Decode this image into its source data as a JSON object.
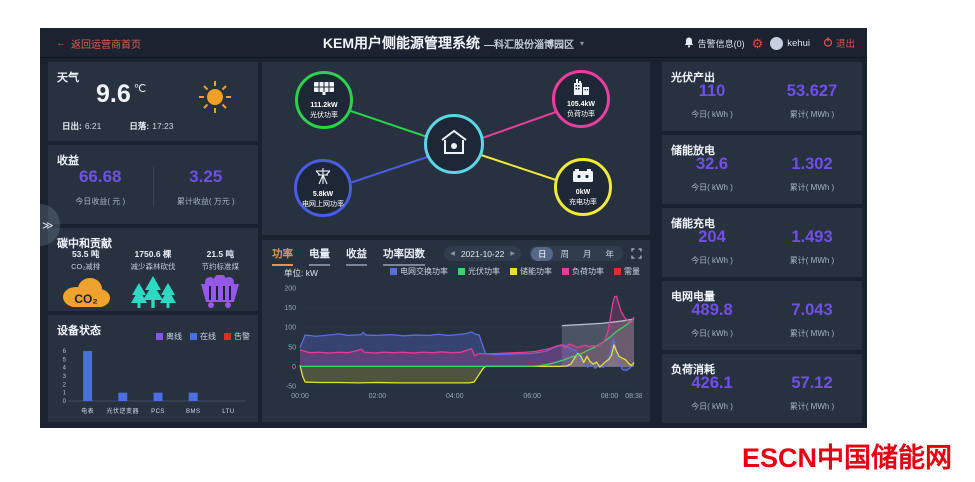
{
  "icons": {
    "back_arrow": "←",
    "chevron_down": "▾",
    "prev": "◀",
    "next": "▶",
    "expand": "≫",
    "gear": "⚙"
  },
  "header": {
    "back_label": "返回运营商首页",
    "title": "KEM用户侧能源管理系统",
    "park": "—科汇股份淄博园区",
    "alarm": "告警信息(0)",
    "user": "kehui",
    "logout": "退出"
  },
  "weather": {
    "title": "天气",
    "temp": "9.6",
    "unit": "℃",
    "sunrise_label": "日出:",
    "sunrise": "6:21",
    "sunset_label": "日落:",
    "sunset": "17:23"
  },
  "revenue": {
    "title": "收益",
    "today": "66.68",
    "today_label": "今日收益( 元 )",
    "total": "3.25",
    "total_label": "累计收益( 万元 )"
  },
  "carbon": {
    "title": "碳中和贡献",
    "co2_text": "CO₂",
    "items": [
      {
        "value": "53.5 吨",
        "label": "CO₂减排",
        "color": "#f0a32c"
      },
      {
        "value": "1750.6 棵",
        "label": "减少森林砍伐",
        "color": "#2ed9c3"
      },
      {
        "value": "21.5 吨",
        "label": "节约标准煤",
        "color": "#9558e8"
      }
    ]
  },
  "device_status": {
    "title": "设备状态",
    "legend": [
      {
        "label": "离线",
        "color": "#8655f0"
      },
      {
        "label": "在线",
        "color": "#4a6fe0"
      },
      {
        "label": "告警",
        "color": "#e02a2a"
      }
    ]
  },
  "flow": {
    "center_color": "#5cd6e6",
    "nodes": [
      {
        "value": "111.2kW",
        "label": "光伏功率",
        "color": "#2bd14b"
      },
      {
        "value": "105.4kW",
        "label": "负荷功率",
        "color": "#ea3e9e"
      },
      {
        "value": "5.8kW",
        "label": "电网上网功率",
        "color": "#4a5de0"
      },
      {
        "value": "0kW",
        "label": "充电功率",
        "color": "#f2ea3a"
      }
    ]
  },
  "power_chart_header": {
    "active_color": "#e8954a",
    "tabs": [
      {
        "label": "功率",
        "active": true
      },
      {
        "label": "电量",
        "active": false
      },
      {
        "label": "收益",
        "active": false
      },
      {
        "label": "功率因数",
        "active": false
      }
    ],
    "date": "2021-10-22",
    "periods": [
      {
        "label": "日",
        "active": true
      },
      {
        "label": "周",
        "active": false
      },
      {
        "label": "月",
        "active": false
      },
      {
        "label": "年",
        "active": false
      }
    ],
    "unit_label": "单位: kW",
    "legend": [
      {
        "label": "电网交换功率",
        "color": "#5a6ee0"
      },
      {
        "label": "光伏功率",
        "color": "#3cd368"
      },
      {
        "label": "储能功率",
        "color": "#e6e03c"
      },
      {
        "label": "负荷功率",
        "color": "#e23e97"
      },
      {
        "label": "需量",
        "color": "#d83228"
      }
    ]
  },
  "chart_data": [
    {
      "type": "line",
      "title": "功率",
      "unit": "kW",
      "xlim": [
        0,
        518
      ],
      "ylim": [
        -50,
        200
      ],
      "yticks": [
        -50,
        0,
        50,
        100,
        150,
        200
      ],
      "xticks": [
        {
          "t": 0,
          "label": "00:00"
        },
        {
          "t": 120,
          "label": "02:00"
        },
        {
          "t": 240,
          "label": "04:00"
        },
        {
          "t": 360,
          "label": "06:00"
        },
        {
          "t": 480,
          "label": "08:00"
        },
        {
          "t": 518,
          "label": "08:38"
        }
      ],
      "series": [
        {
          "name": "需量",
          "color": "#b9c0cd",
          "fill": 0.25,
          "points": [
            [
              406,
              104
            ],
            [
              440,
              107
            ],
            [
              470,
              110
            ],
            [
              500,
              116
            ],
            [
              518,
              121
            ]
          ]
        },
        {
          "name": "电网交换功率",
          "color": "#5a6ee0",
          "fill": 0.3,
          "points": [
            [
              0,
              48
            ],
            [
              8,
              80
            ],
            [
              25,
              77
            ],
            [
              45,
              80
            ],
            [
              60,
              83
            ],
            [
              75,
              79
            ],
            [
              95,
              81
            ],
            [
              98,
              87
            ],
            [
              102,
              80
            ],
            [
              120,
              79
            ],
            [
              140,
              81
            ],
            [
              160,
              78
            ],
            [
              180,
              80
            ],
            [
              200,
              79
            ],
            [
              215,
              82
            ],
            [
              230,
              79
            ],
            [
              245,
              81
            ],
            [
              258,
              84
            ],
            [
              266,
              88
            ],
            [
              272,
              82
            ],
            [
              278,
              80
            ],
            [
              283,
              55
            ],
            [
              288,
              32
            ],
            [
              300,
              30
            ],
            [
              320,
              31
            ],
            [
              340,
              32
            ],
            [
              360,
              33
            ],
            [
              380,
              38
            ],
            [
              392,
              47
            ],
            [
              400,
              52
            ],
            [
              408,
              55
            ],
            [
              415,
              50
            ],
            [
              420,
              45
            ],
            [
              428,
              40
            ],
            [
              434,
              22
            ],
            [
              440,
              8
            ],
            [
              446,
              -2
            ],
            [
              452,
              6
            ],
            [
              458,
              -5
            ],
            [
              464,
              4
            ],
            [
              470,
              -3
            ],
            [
              476,
              8
            ],
            [
              481,
              35
            ],
            [
              486,
              70
            ],
            [
              490,
              45
            ],
            [
              494,
              15
            ],
            [
              500,
              -8
            ],
            [
              506,
              -10
            ],
            [
              512,
              -4
            ],
            [
              518,
              10
            ]
          ]
        },
        {
          "name": "储能功率",
          "color": "#e6e03c",
          "fill": 0.2,
          "points": [
            [
              0,
              3
            ],
            [
              4,
              -25
            ],
            [
              8,
              -40
            ],
            [
              30,
              -41
            ],
            [
              60,
              -41
            ],
            [
              90,
              -42
            ],
            [
              120,
              -41
            ],
            [
              150,
              -42
            ],
            [
              180,
              -42
            ],
            [
              210,
              -42
            ],
            [
              240,
              -42
            ],
            [
              262,
              -42
            ],
            [
              270,
              -40
            ],
            [
              278,
              -20
            ],
            [
              284,
              -5
            ],
            [
              288,
              0
            ],
            [
              310,
              0
            ],
            [
              340,
              0
            ],
            [
              370,
              0
            ],
            [
              400,
              0
            ],
            [
              414,
              1
            ],
            [
              420,
              6
            ],
            [
              426,
              22
            ],
            [
              431,
              33
            ],
            [
              436,
              25
            ],
            [
              440,
              10
            ],
            [
              445,
              26
            ],
            [
              450,
              12
            ],
            [
              455,
              6
            ],
            [
              460,
              11
            ],
            [
              465,
              -2
            ],
            [
              470,
              6
            ],
            [
              474,
              12
            ],
            [
              479,
              18
            ],
            [
              483,
              28
            ],
            [
              487,
              55
            ],
            [
              491,
              38
            ],
            [
              495,
              25
            ],
            [
              500,
              21
            ],
            [
              505,
              17
            ],
            [
              510,
              7
            ],
            [
              514,
              2
            ],
            [
              518,
              10
            ]
          ]
        },
        {
          "name": "光伏功率",
          "color": "#3cd368",
          "fill": 0.12,
          "points": [
            [
              0,
              0
            ],
            [
              100,
              0
            ],
            [
              200,
              0
            ],
            [
              300,
              0
            ],
            [
              360,
              0
            ],
            [
              372,
              2
            ],
            [
              384,
              5
            ],
            [
              396,
              10
            ],
            [
              408,
              16
            ],
            [
              418,
              22
            ],
            [
              428,
              28
            ],
            [
              438,
              34
            ],
            [
              448,
              42
            ],
            [
              458,
              50
            ],
            [
              466,
              58
            ],
            [
              474,
              66
            ],
            [
              482,
              76
            ],
            [
              490,
              88
            ],
            [
              498,
              97
            ],
            [
              506,
              106
            ],
            [
              512,
              114
            ],
            [
              518,
              122
            ]
          ]
        },
        {
          "name": "负荷功率",
          "color": "#e23e97",
          "fill": 0.22,
          "points": [
            [
              0,
              42
            ],
            [
              15,
              35
            ],
            [
              30,
              36
            ],
            [
              45,
              34
            ],
            [
              60,
              36
            ],
            [
              75,
              35
            ],
            [
              90,
              41
            ],
            [
              95,
              44
            ],
            [
              100,
              36
            ],
            [
              115,
              34
            ],
            [
              130,
              36
            ],
            [
              145,
              35
            ],
            [
              160,
              36
            ],
            [
              175,
              34
            ],
            [
              190,
              36
            ],
            [
              205,
              35
            ],
            [
              220,
              37
            ],
            [
              235,
              35
            ],
            [
              250,
              36
            ],
            [
              260,
              42
            ],
            [
              266,
              45
            ],
            [
              271,
              27
            ],
            [
              277,
              33
            ],
            [
              290,
              32
            ],
            [
              305,
              33
            ],
            [
              320,
              34
            ],
            [
              335,
              35
            ],
            [
              350,
              36
            ],
            [
              365,
              38
            ],
            [
              380,
              43
            ],
            [
              390,
              47
            ],
            [
              398,
              52
            ],
            [
              405,
              55
            ],
            [
              412,
              49
            ],
            [
              418,
              57
            ],
            [
              424,
              53
            ],
            [
              430,
              48
            ],
            [
              436,
              51
            ],
            [
              442,
              54
            ],
            [
              448,
              50
            ],
            [
              454,
              53
            ],
            [
              460,
              51
            ],
            [
              466,
              57
            ],
            [
              472,
              65
            ],
            [
              477,
              85
            ],
            [
              481,
              120
            ],
            [
              485,
              160
            ],
            [
              488,
              178
            ],
            [
              491,
              179
            ],
            [
              494,
              162
            ],
            [
              498,
              140
            ],
            [
              503,
              126
            ],
            [
              508,
              117
            ],
            [
              513,
              112
            ],
            [
              518,
              126
            ]
          ]
        }
      ]
    },
    {
      "type": "bar",
      "title": "设备状态",
      "categories": [
        "电表",
        "光伏逆变器",
        "PCS",
        "BMS",
        "LTU"
      ],
      "ylim": [
        0,
        6
      ],
      "yticks": [
        0,
        1,
        2,
        3,
        4,
        5,
        6
      ],
      "series": [
        {
          "name": "离线",
          "color": "#8655f0",
          "values": [
            0,
            0,
            0,
            0,
            0
          ]
        },
        {
          "name": "在线",
          "color": "#4a6fe0",
          "values": [
            6,
            1,
            1,
            1,
            0
          ]
        },
        {
          "name": "告警",
          "color": "#e02a2a",
          "values": [
            0,
            0,
            0,
            0,
            0
          ]
        }
      ]
    }
  ],
  "stats": [
    {
      "title": "光伏产出",
      "today": "110",
      "today_label": "今日( kWh )",
      "total": "53.627",
      "total_label": "累计( MWh )"
    },
    {
      "title": "储能放电",
      "today": "32.6",
      "today_label": "今日( kWh )",
      "total": "1.302",
      "total_label": "累计( MWh )"
    },
    {
      "title": "储能充电",
      "today": "204",
      "today_label": "今日( kWh )",
      "total": "1.493",
      "total_label": "累计( MWh )"
    },
    {
      "title": "电网电量",
      "today": "489.8",
      "today_label": "今日( kWh )",
      "total": "7.043",
      "total_label": "累计( MWh )"
    },
    {
      "title": "负荷消耗",
      "today": "426.1",
      "today_label": "今日( kWh )",
      "total": "57.12",
      "total_label": "累计( MWh )"
    }
  ],
  "footer": {
    "logo_latin": "ESCN",
    "logo_cn": "中国储能网"
  }
}
